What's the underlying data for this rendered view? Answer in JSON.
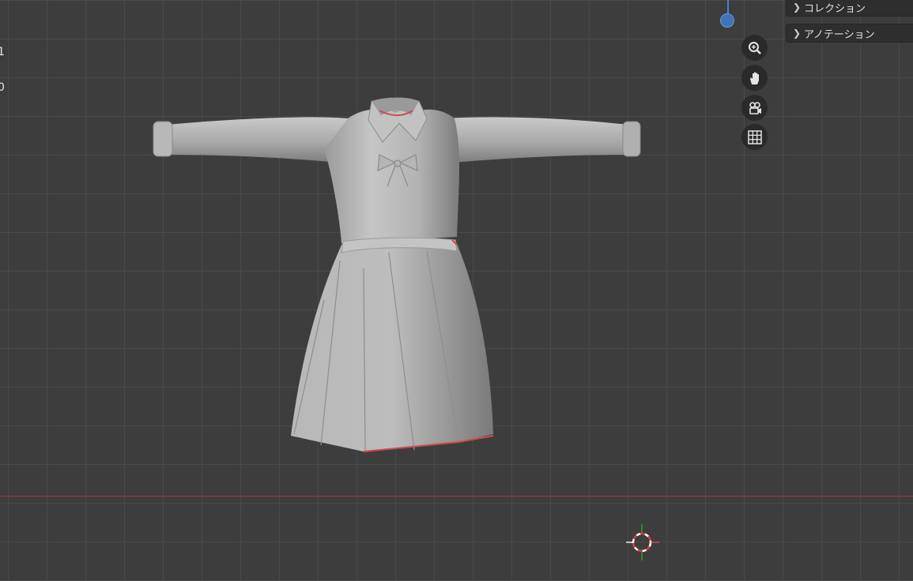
{
  "viewport": {
    "ruler_labels": [
      "1",
      "0"
    ],
    "colors": {
      "background": "#3d3d3d",
      "grid": "#4a4a4a",
      "x_axis": "#a33a3a",
      "z_axis": "#4a82c8"
    }
  },
  "nav_gizmo": {
    "buttons": [
      {
        "name": "zoom",
        "icon": "zoom-icon"
      },
      {
        "name": "pan",
        "icon": "hand-icon"
      },
      {
        "name": "camera",
        "icon": "camera-icon"
      },
      {
        "name": "ortho",
        "icon": "grid-icon"
      }
    ]
  },
  "outliner": {
    "items": [
      {
        "label": "コレクション",
        "icon": "chevron-right-icon"
      },
      {
        "label": "アノテーション",
        "icon": "chevron-right-icon"
      }
    ]
  },
  "scene": {
    "object": "school-uniform-mesh"
  }
}
